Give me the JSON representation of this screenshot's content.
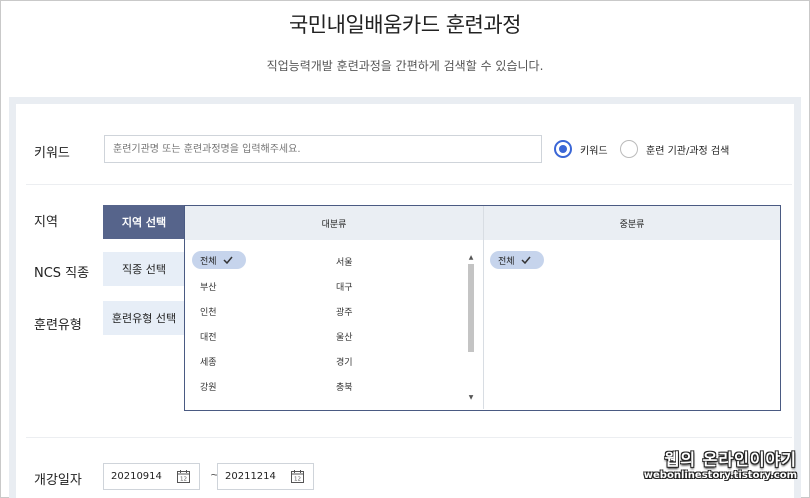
{
  "header": {
    "title": "국민내일배움카드 훈련과정",
    "subtitle": "직업능력개발 훈련과정을 간편하게 검색할 수 있습니다."
  },
  "keyword": {
    "label": "키워드",
    "placeholder": "훈련기관명 또는 훈련과정명을 입력해주세요.",
    "radio_options": [
      {
        "label": "키워드",
        "selected": true
      },
      {
        "label": "훈련 기관/과정 검색",
        "selected": false
      }
    ]
  },
  "filters": {
    "region": {
      "label": "지역",
      "button": "지역 선택"
    },
    "ncs": {
      "label": "NCS 직종",
      "button": "직종 선택"
    },
    "training_type": {
      "label": "훈련유형",
      "button": "훈련유형 선택"
    }
  },
  "region_picker": {
    "major_header": "대분류",
    "minor_header": "중분류",
    "major_items": [
      {
        "label": "전체",
        "selected": true
      },
      {
        "label": "서울",
        "selected": false
      },
      {
        "label": "부산",
        "selected": false
      },
      {
        "label": "대구",
        "selected": false
      },
      {
        "label": "인천",
        "selected": false
      },
      {
        "label": "광주",
        "selected": false
      },
      {
        "label": "대전",
        "selected": false
      },
      {
        "label": "울산",
        "selected": false
      },
      {
        "label": "세종",
        "selected": false
      },
      {
        "label": "경기",
        "selected": false
      },
      {
        "label": "강원",
        "selected": false
      },
      {
        "label": "충북",
        "selected": false
      }
    ],
    "minor_items": [
      {
        "label": "전체",
        "selected": true
      }
    ]
  },
  "dates": {
    "label": "개강일자",
    "start": "20210914",
    "separator": "~",
    "end": "20211214"
  },
  "watermark": {
    "main": "웹의 온라인이야기",
    "url": "webonlinestory.tistory.com"
  },
  "colors": {
    "accent": "#3a66d6",
    "active_button": "#56648b",
    "inactive_button": "#e7eef7",
    "chip": "#c6d4ec",
    "panel_border": "#e9edf2"
  },
  "icons": {
    "check": "check-icon",
    "calendar": "calendar-icon"
  }
}
